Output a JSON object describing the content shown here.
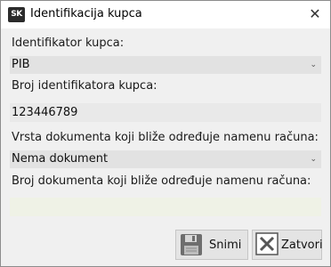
{
  "window": {
    "logo_text": "SK",
    "title": "Identifikacija kupca",
    "close_glyph": "✕"
  },
  "form": {
    "customer_id_label": "Identifikator kupca:",
    "customer_id_value": "PIB",
    "id_number_label": "Broj identifikatora kupca:",
    "id_number_value": "123446789",
    "doc_type_label": "Vrsta dokumenta koji bliže određuje namenu računa:",
    "doc_type_value": "Nema dokument",
    "doc_number_label": "Broj dokumenta koji bliže određuje namenu računa:",
    "doc_number_value": "",
    "dropdown_icon": "chevron-down-icon"
  },
  "buttons": {
    "save_label": "Snimi",
    "save_icon": "floppy-disk-icon",
    "close_label": "Zatvori",
    "close_icon": "close-box-icon"
  },
  "colors": {
    "field_bg": "#e2e2e2",
    "empty_field_bg": "#eff2e6",
    "button_bg": "#e4e4e4"
  }
}
